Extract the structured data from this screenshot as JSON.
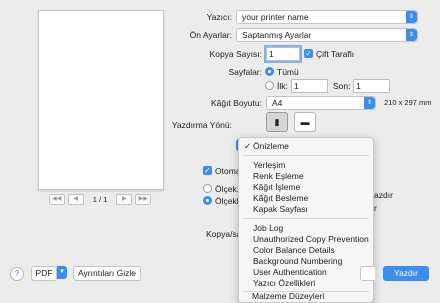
{
  "preview": {
    "page_indicator": "1 / 1",
    "first": "◀◀",
    "prev": "◀",
    "next": "▶",
    "last": "▶▶"
  },
  "form": {
    "printer_label": "Yazıcı:",
    "printer_value": "your printer name",
    "presets_label": "Ön Ayarlar:",
    "presets_value": "Saptanmış Ayarlar",
    "copies_label": "Kopya Sayısı:",
    "copies_value": "1",
    "double_sided_label": "Çift Taraflı",
    "pages_label": "Sayfalar:",
    "all_label": "Tümü",
    "from_label": "İlk:",
    "from_value": "1",
    "to_label": "Son:",
    "to_value": "1",
    "paper_label": "Kâğıt Boyutu:",
    "paper_value": "A4",
    "paper_dims": "210 x 297 mm",
    "orientation_label": "Yazdırma Yönü:"
  },
  "background": {
    "auto_rotate": "Otomat",
    "scale_label": "Ölçek:",
    "scale_fit": "Ölçekle",
    "copies_per": "Kopya/say",
    "frag1": "azdır",
    "frag2": "r"
  },
  "menu": {
    "items": [
      "Önizleme",
      "Yerleşim",
      "Renk Eşleme",
      "Kâğıt İşleme",
      "Kâğıt Besleme",
      "Kapak Sayfası",
      "Job Log",
      "Unauthorized Copy Prevention",
      "Color Balance Details",
      "Background Numbering",
      "User Authentication",
      "Yazıcı Özellikleri",
      "Malzeme Düzeyleri"
    ]
  },
  "bottom": {
    "help": "?",
    "pdf": "PDF",
    "hide_details": "Ayrıntıları Gizle",
    "print": "Yazdır"
  }
}
